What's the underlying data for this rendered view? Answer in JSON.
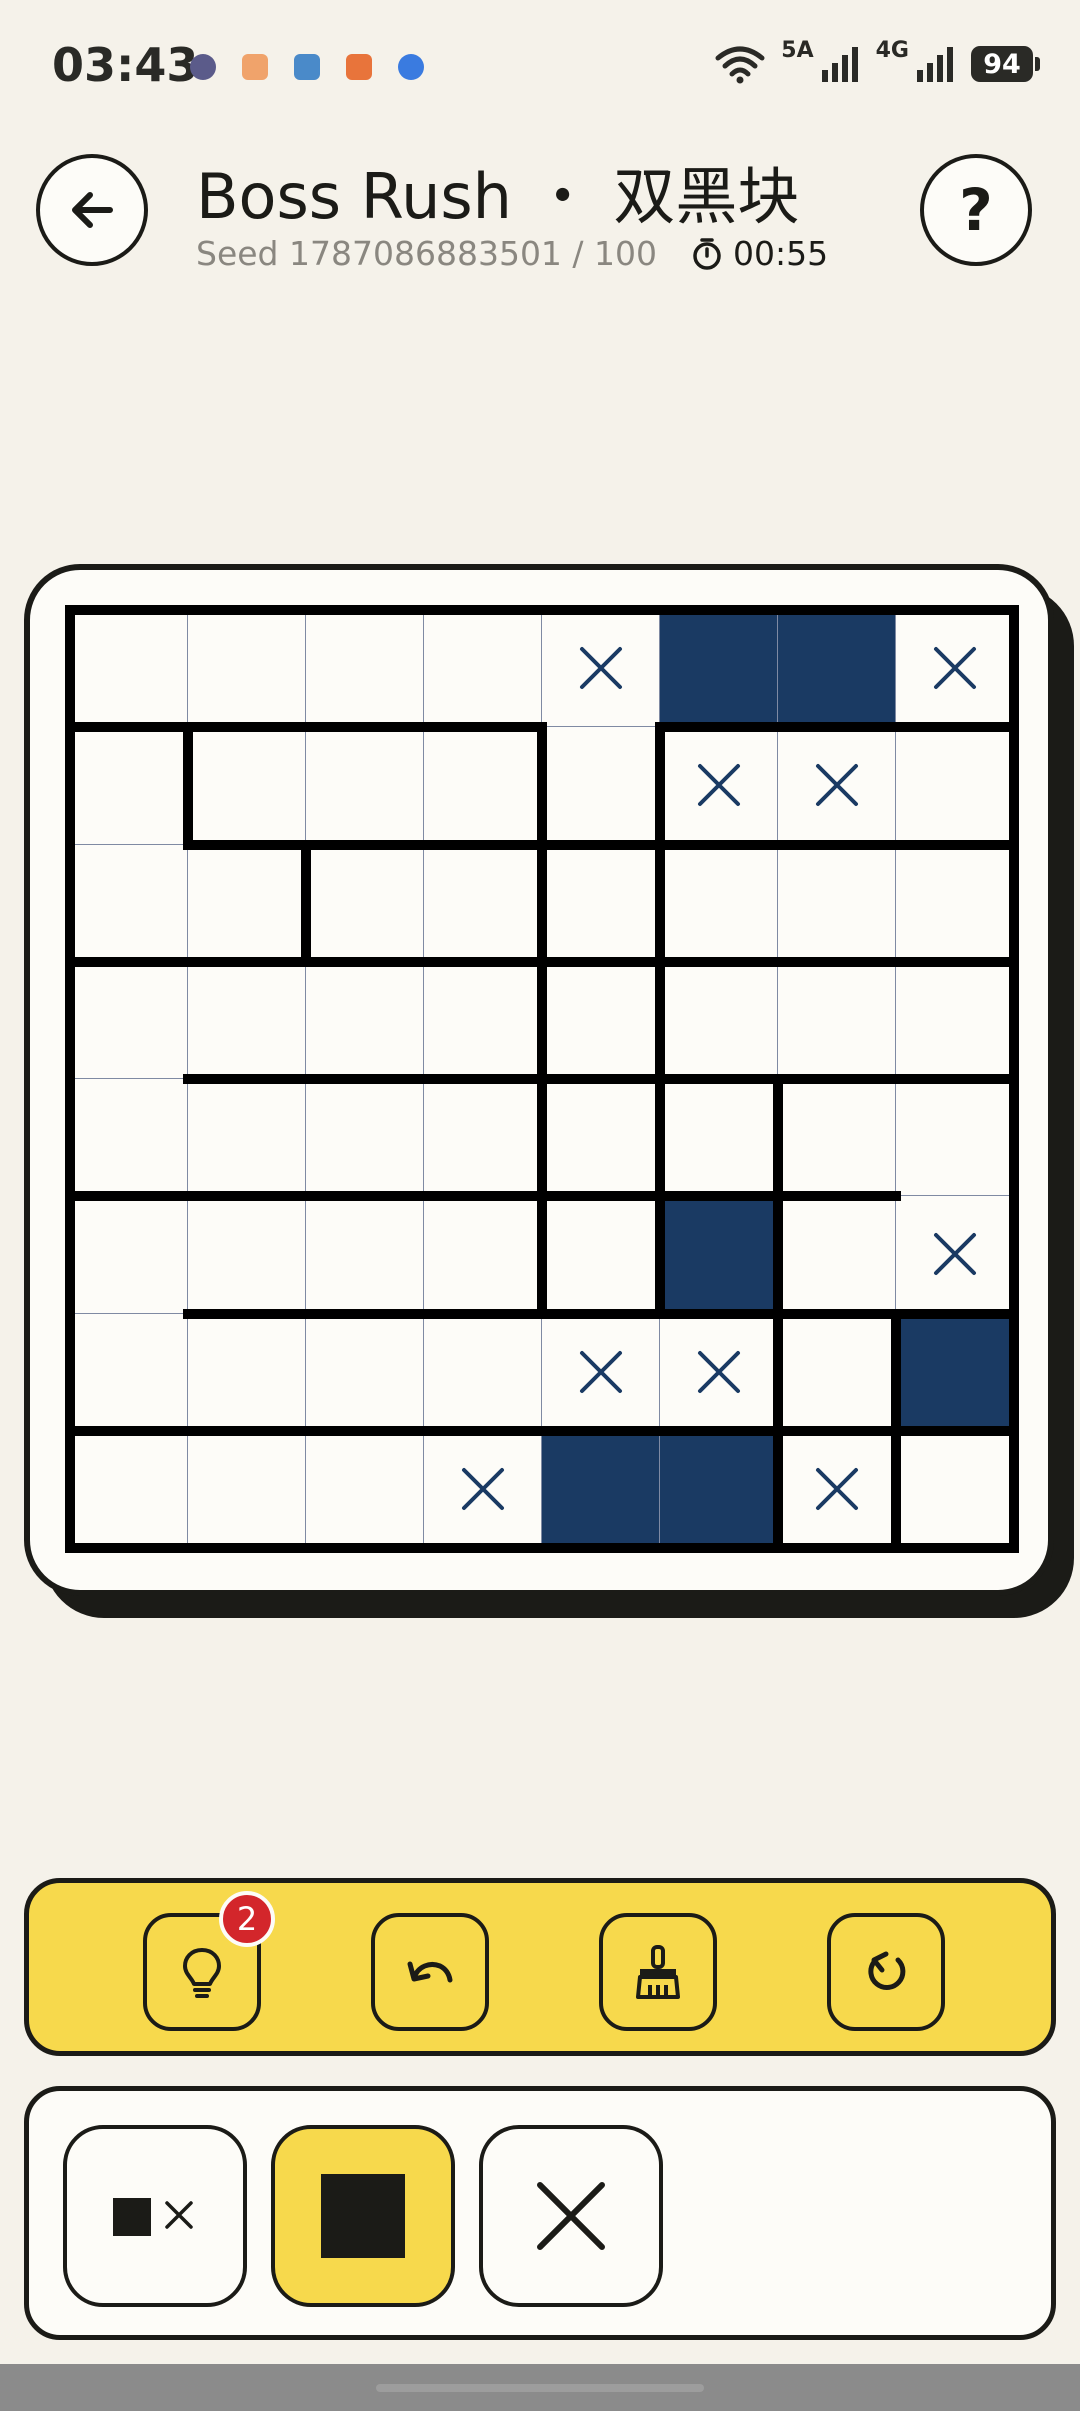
{
  "status_bar": {
    "time": "03:43",
    "network_5g": "5A",
    "network_4g": "4G",
    "battery": "94",
    "notification_icons": [
      "app-icon-1",
      "app-icon-2",
      "app-icon-3",
      "app-icon-4",
      "app-icon-5"
    ]
  },
  "header": {
    "title": "Boss Rush ・ 双黑块",
    "seed": "Seed 1787086883501 / 100",
    "timer": "00:55",
    "back_icon": "arrow-left-icon",
    "help_icon": "?"
  },
  "colors": {
    "background": "#f5f2ea",
    "accent_yellow": "#f7d94c",
    "filled_cell": "#1a3a63",
    "cross_mark": "#1a3a63",
    "badge": "#d3262b",
    "ink": "#1b1b17"
  },
  "board": {
    "rows": 8,
    "cols": 8,
    "cells": [
      [
        ".",
        ".",
        ".",
        ".",
        "x",
        "#",
        "#",
        "x"
      ],
      [
        ".",
        ".",
        ".",
        ".",
        ".",
        "x",
        "x",
        "."
      ],
      [
        ".",
        ".",
        ".",
        ".",
        ".",
        ".",
        ".",
        "."
      ],
      [
        ".",
        ".",
        ".",
        ".",
        ".",
        ".",
        ".",
        "."
      ],
      [
        ".",
        ".",
        ".",
        ".",
        ".",
        ".",
        ".",
        "."
      ],
      [
        ".",
        ".",
        ".",
        ".",
        ".",
        "#",
        ".",
        "x"
      ],
      [
        ".",
        ".",
        ".",
        ".",
        "x",
        "x",
        ".",
        "#"
      ],
      [
        ".",
        ".",
        ".",
        "x",
        "#",
        "#",
        "x",
        "."
      ]
    ],
    "region_walls_h": [
      [
        1,
        0,
        4
      ],
      [
        1,
        5,
        7
      ],
      [
        1,
        7,
        8
      ],
      [
        2,
        1,
        8
      ],
      [
        3,
        0,
        8
      ],
      [
        4,
        1,
        8
      ],
      [
        5,
        0,
        7
      ],
      [
        6,
        1,
        8
      ],
      [
        7,
        0,
        8
      ]
    ],
    "region_walls_v": [
      [
        0,
        5,
        1
      ],
      [
        0,
        7,
        1
      ],
      [
        1,
        1,
        2
      ],
      [
        2,
        2,
        3
      ],
      [
        3,
        4,
        4
      ],
      [
        4,
        1,
        6
      ],
      [
        4,
        7,
        5
      ],
      [
        5,
        1,
        6
      ],
      [
        5,
        5,
        6
      ],
      [
        6,
        4,
        8
      ],
      [
        7,
        6,
        8
      ]
    ]
  },
  "toolbar": {
    "hint_badge": "2",
    "tools": [
      "lightbulb-icon",
      "undo-icon",
      "broom-icon",
      "restart-icon"
    ]
  },
  "modes": {
    "items": [
      "fill-and-mark-icon",
      "fill-icon",
      "cross-icon"
    ],
    "active_index": 1
  }
}
